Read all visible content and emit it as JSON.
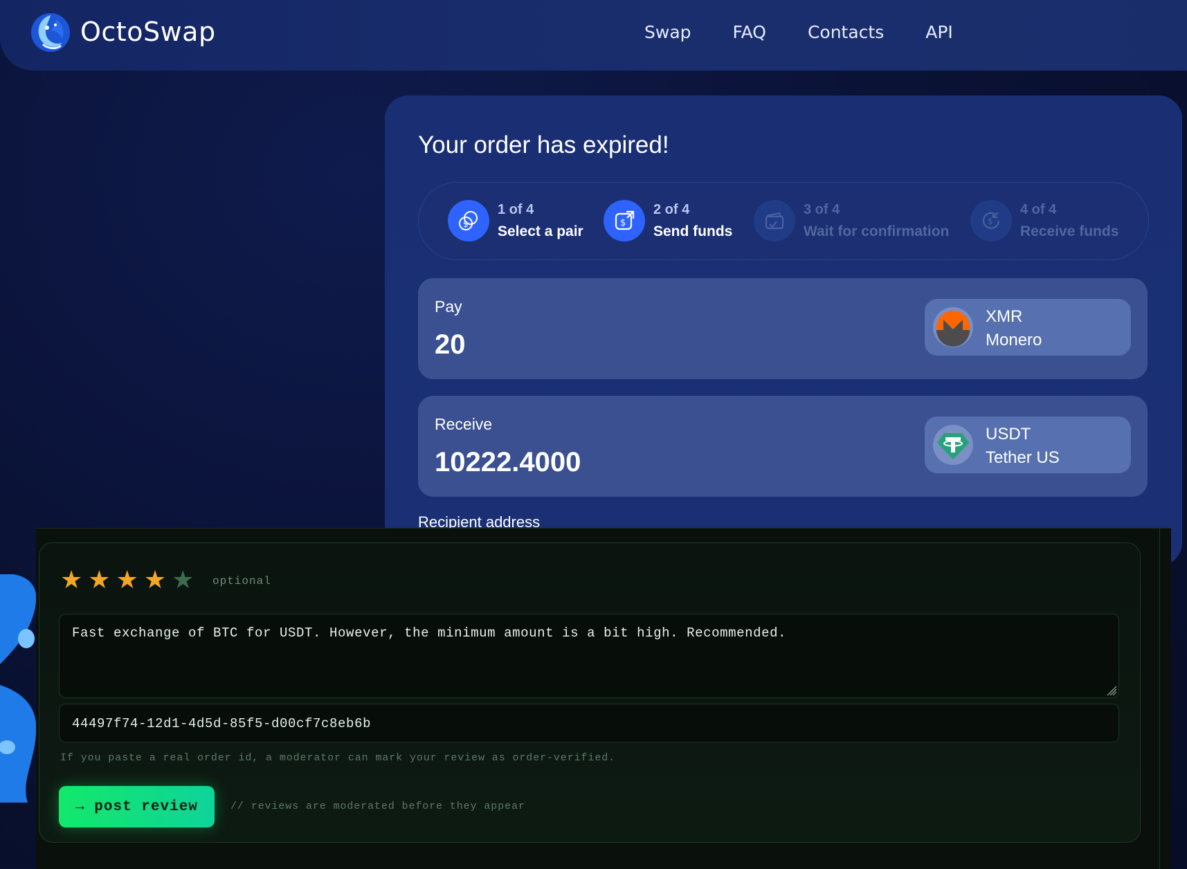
{
  "nav": {
    "brand": "OctoSwap",
    "links": [
      "Swap",
      "FAQ",
      "Contacts",
      "API"
    ]
  },
  "order": {
    "title": "Your order has expired!",
    "steps": [
      {
        "num": "1 of 4",
        "name": "Select a pair",
        "state": "active",
        "icon": "coins-icon"
      },
      {
        "num": "2 of 4",
        "name": "Send funds",
        "state": "active",
        "icon": "send-funds-icon"
      },
      {
        "num": "3 of 4",
        "name": "Wait for confirmation",
        "state": "inactive",
        "icon": "wallet-check-icon"
      },
      {
        "num": "4 of 4",
        "name": "Receive funds",
        "state": "inactive",
        "icon": "receive-funds-icon"
      }
    ],
    "pay": {
      "label": "Pay",
      "amount": "20",
      "coin_code": "XMR",
      "coin_name": "Monero"
    },
    "receive": {
      "label": "Receive",
      "amount": "10222.4000",
      "coin_code": "USDT",
      "coin_name": "Tether US"
    },
    "recipient_label": "Recipient address"
  },
  "review": {
    "rating": 4,
    "max_rating": 5,
    "stars": [
      "★",
      "★",
      "★",
      "★",
      "★"
    ],
    "optional_label": "optional",
    "text": "Fast exchange of BTC for USDT. However, the minimum amount is a bit high. Recommended.",
    "order_id": "44497f74-12d1-4d5d-85f5-d00cf7c8eb6b",
    "hint": "If you paste a real order id, a moderator can mark your review as order-verified.",
    "submit_label": "→ post review",
    "moderation_note": "// reviews are moderated before they appear"
  },
  "colors": {
    "nav_bg": "#142563",
    "card_bg": "#1a2f73",
    "accent_blue": "#2e63ff",
    "star_on": "#f5a524",
    "star_off": "#3f6b4d",
    "button_green": "#13e86a"
  }
}
